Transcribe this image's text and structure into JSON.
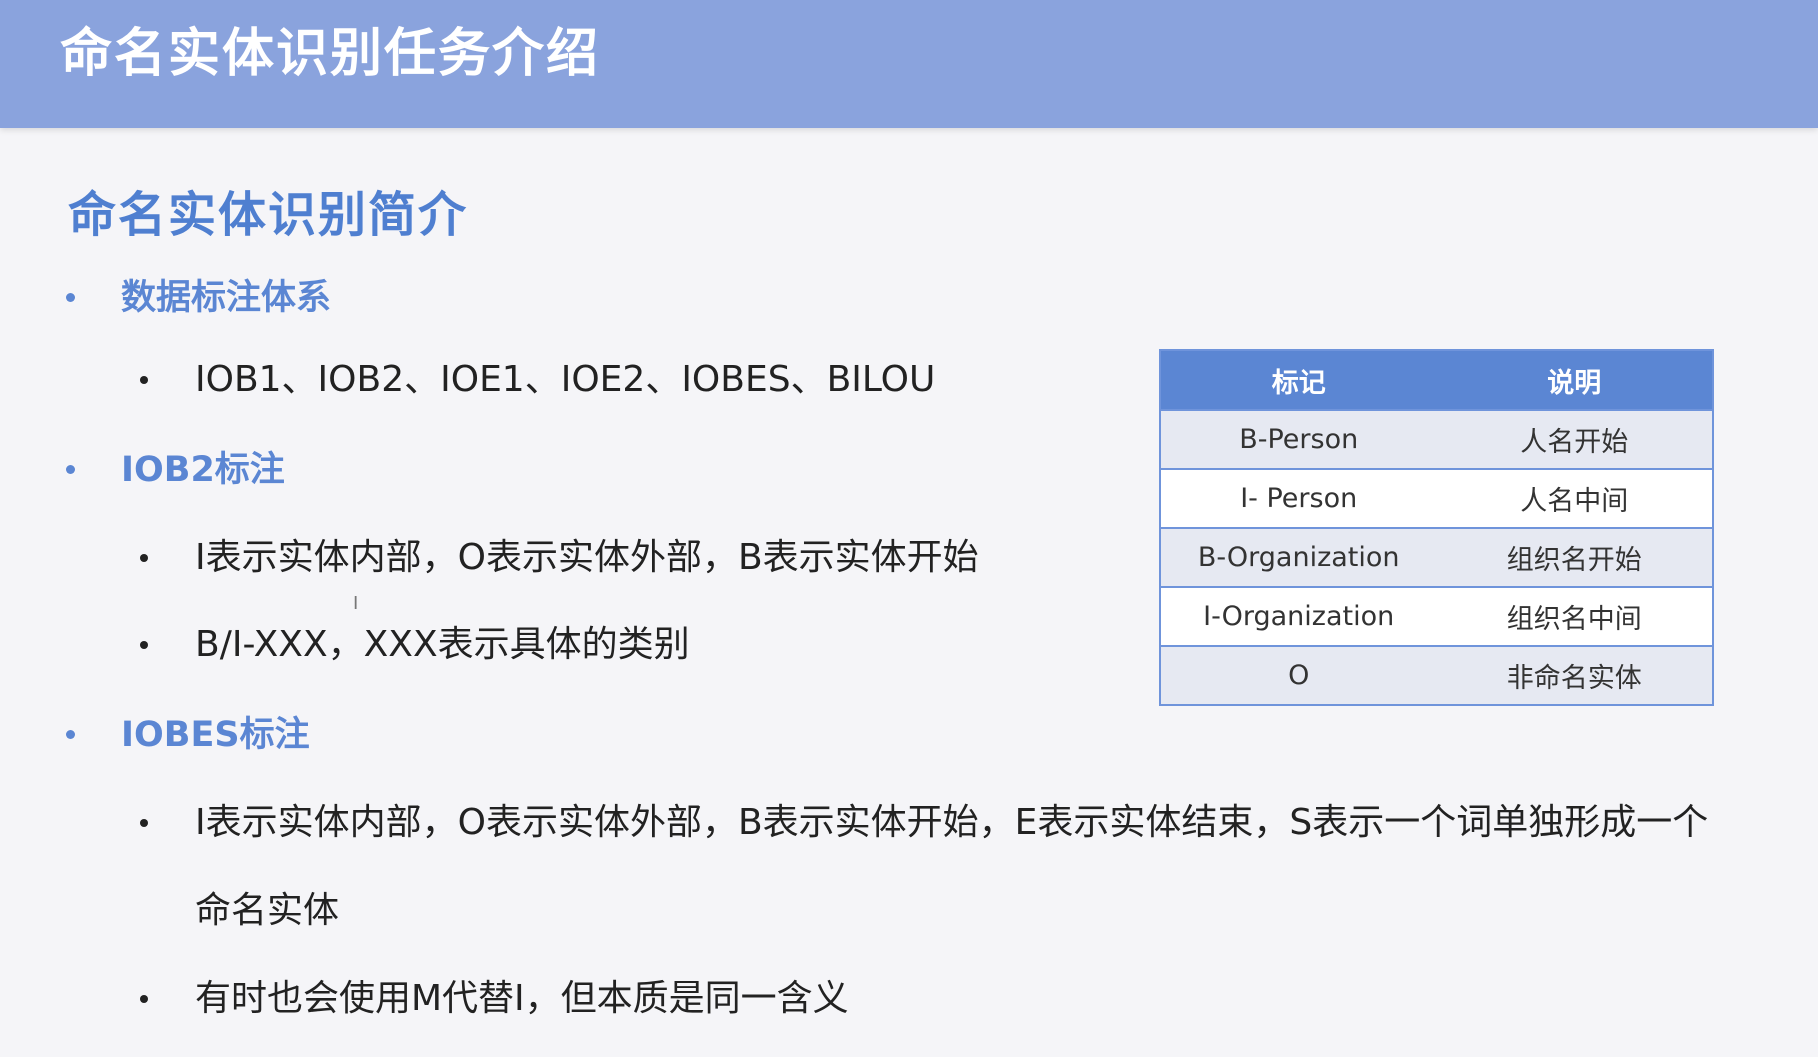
{
  "header": {
    "title": "命名实体识别任务介绍"
  },
  "section": {
    "title": "命名实体识别简介"
  },
  "bullets": {
    "b1": {
      "label": "数据标注体系",
      "items": [
        "IOB1、IOB2、IOE1、IOE2、IOBES、BILOU"
      ]
    },
    "b2": {
      "label": "IOB2标注",
      "items": [
        "I表示实体内部，O表示实体外部，B表示实体开始",
        "B/I-XXX，XXX表示具体的类别"
      ]
    },
    "b3": {
      "label": "IOBES标注",
      "items": [
        "I表示实体内部，O表示实体外部，B表示实体开始，E表示实体结束，S表示一个词单独形成一个",
        "有时也会使用M代替I，但本质是同一含义"
      ],
      "continuation": "命名实体"
    }
  },
  "table": {
    "headers": [
      "标记",
      "说明"
    ],
    "rows": [
      [
        "B-Person",
        "人名开始"
      ],
      [
        "I- Person",
        "人名中间"
      ],
      [
        "B-Organization",
        "组织名开始"
      ],
      [
        "I-Organization",
        "组织名中间"
      ],
      [
        "O",
        "非命名实体"
      ]
    ]
  },
  "colors": {
    "header_bg": "#8aa3dd",
    "accent": "#5b86d3",
    "title_blue": "#4f7fd0",
    "table_row_alt": "#e6e9f2"
  },
  "icons": {
    "cursor": "text-cursor-icon"
  }
}
